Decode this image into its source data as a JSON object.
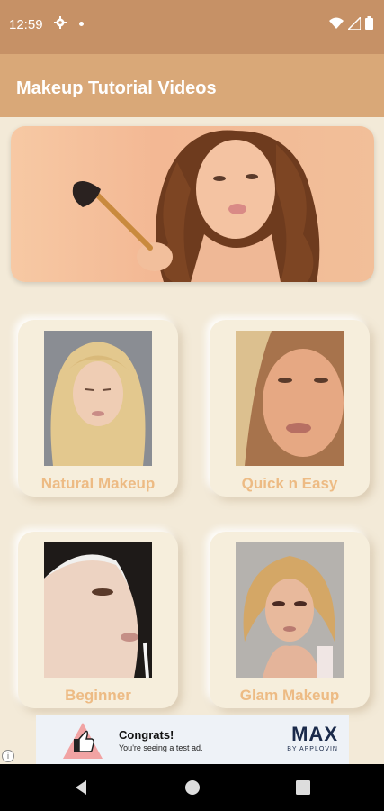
{
  "status_bar": {
    "time": "12:59",
    "icons": [
      "gear-icon",
      "dot-icon",
      "wifi-icon",
      "signal-icon",
      "battery-icon"
    ]
  },
  "app_bar": {
    "title": "Makeup Tutorial Videos"
  },
  "categories": [
    {
      "label": "Natural Makeup"
    },
    {
      "label": "Quick n Easy"
    },
    {
      "label": "Beginner"
    },
    {
      "label": "Glam Makeup"
    }
  ],
  "ad": {
    "title": "Congrats!",
    "subtitle": "You're seeing a test ad.",
    "brand": "MAX",
    "brand_sub": "BY APPLOVIN",
    "info": "i"
  },
  "nav": {
    "icons": [
      "back-icon",
      "home-icon",
      "recents-icon"
    ]
  },
  "colors": {
    "status_bar": "#c69166",
    "app_bar": "#d9a878",
    "background": "#f3ead8",
    "label": "#edbb84"
  }
}
